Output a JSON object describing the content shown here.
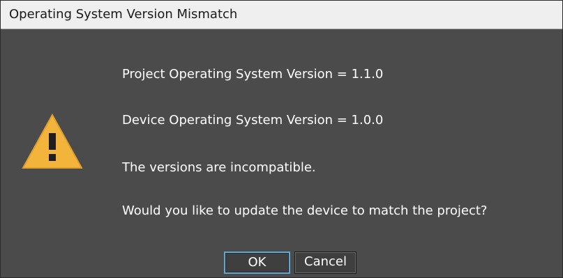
{
  "window": {
    "title": "Operating System Version Mismatch"
  },
  "icon": {
    "name": "warning-icon",
    "color": "#f2b43b",
    "glyph_color": "#1f1f1f"
  },
  "messages": {
    "project_version": "Project Operating System Version = 1.1.0",
    "device_version": "Device Operating System Version = 1.0.0",
    "incompatible": "The versions are incompatible.",
    "question": "Would you like to update the device to match the project?"
  },
  "buttons": {
    "ok": "OK",
    "cancel": "Cancel"
  }
}
